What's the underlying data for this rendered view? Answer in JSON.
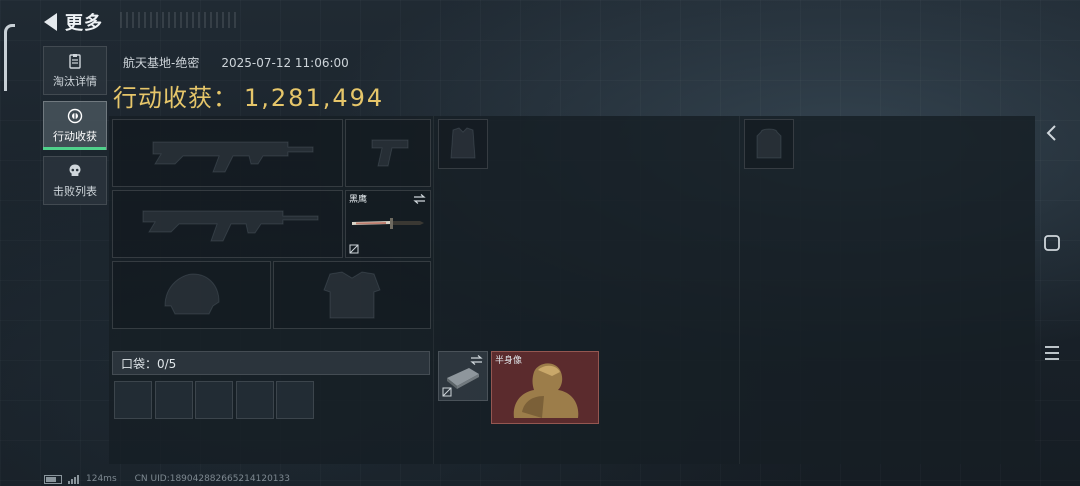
{
  "header": {
    "title": "更多"
  },
  "tabs": [
    {
      "label": "淘汰详情",
      "icon": "clipboard-icon",
      "active": false
    },
    {
      "label": "行动收获",
      "icon": "harvest-coin-icon",
      "active": true
    },
    {
      "label": "击败列表",
      "icon": "skull-icon",
      "active": false
    }
  ],
  "match": {
    "location": "航天基地-绝密",
    "datetime": "2025-07-12 11:06:00"
  },
  "harvest": {
    "label": "行动收获：",
    "value": "1,281,494"
  },
  "equipment": {
    "knife_name": "黑鹰",
    "pocket_label": "口袋：0/5",
    "pocket_slots": 5
  },
  "backpack": {
    "relic_name": "半身像"
  },
  "status": {
    "ping": "124ms",
    "uid": "CN UID:1890428826652141201​33"
  },
  "colors": {
    "accent": "#4fd18b",
    "harvest_gold": "#e6c66a",
    "relic_bg": "#5b2b2d"
  }
}
